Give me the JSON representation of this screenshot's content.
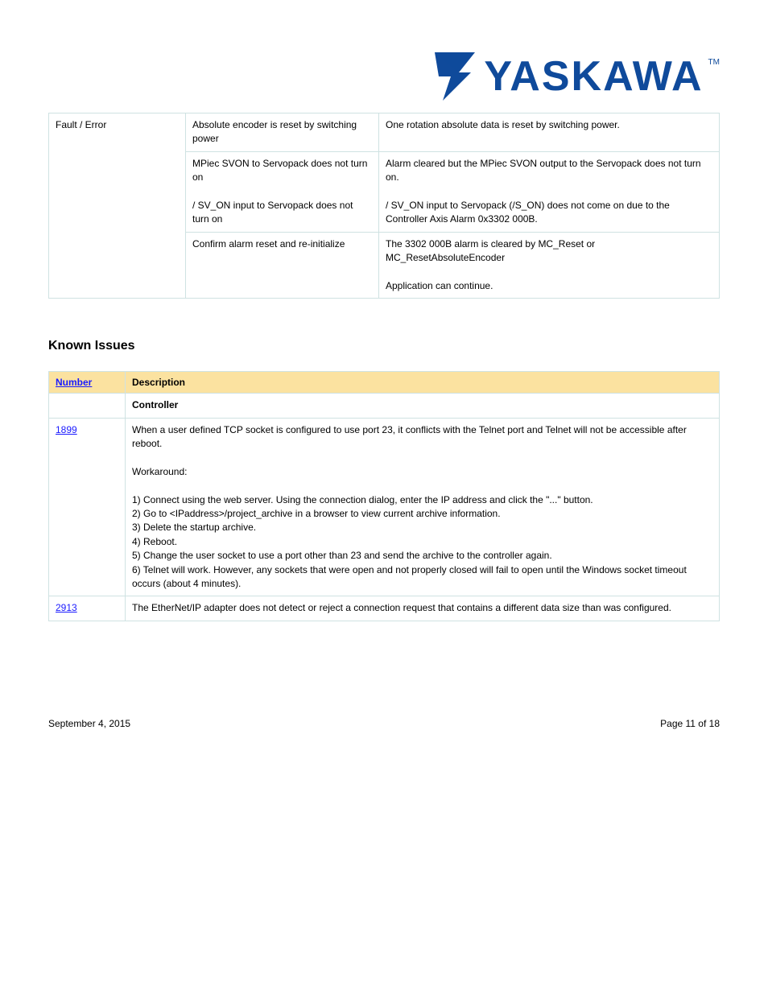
{
  "logo": {
    "name": "YASKAWA",
    "tm": "TM"
  },
  "topTable": {
    "rows": [
      {
        "label": "Fault / Error",
        "mid": "Absolute encoder is reset by switching power",
        "right": "One rotation absolute data is reset by switching power."
      },
      {
        "label": "",
        "mid": "MPiec SVON to Servopack does not turn on\n\n / SV_ON input to Servopack does not turn on",
        "right": "Alarm cleared but the MPiec SVON output to the Servopack does not turn on.\n\n/ SV_ON input to Servopack (/S_ON) does not come on due to the Controller Axis Alarm 0x3302 000B."
      },
      {
        "label": "",
        "mid": "Confirm alarm reset and re-initialize",
        "right": "The 3302 000B alarm is cleared by MC_Reset or MC_ResetAbsoluteEncoder\n\nApplication can continue."
      }
    ]
  },
  "sectionTitle": "Known Issues",
  "statusTable": {
    "headers": [
      "Number",
      "Description"
    ],
    "rows": [
      {
        "num": "",
        "desc": "Controller"
      },
      {
        "num": "1899",
        "numLink": true,
        "desc": "When a user defined TCP socket is configured to use port 23, it conflicts with the Telnet port and Telnet will not be accessible after reboot.\n\nWorkaround:\n\n1) Connect using the web server. Using the connection dialog, enter the IP address and click the \"...\" button.\n2) Go to <IPaddress>/project_archive in a browser to view current archive information.\n3) Delete the startup archive.\n4) Reboot.\n5) Change the user socket to use a port other than 23 and send the archive to the controller again.\n6) Telnet will work. However, any sockets that were open and not properly closed will fail to open until the Windows socket timeout occurs (about 4 minutes)."
      },
      {
        "num": "2913",
        "numLink": true,
        "desc": "The EtherNet/IP adapter does not detect or reject a connection request that contains a different data size than was configured."
      }
    ]
  },
  "footer": {
    "left": "September 4, 2015",
    "right": "Page 11 of 18"
  }
}
